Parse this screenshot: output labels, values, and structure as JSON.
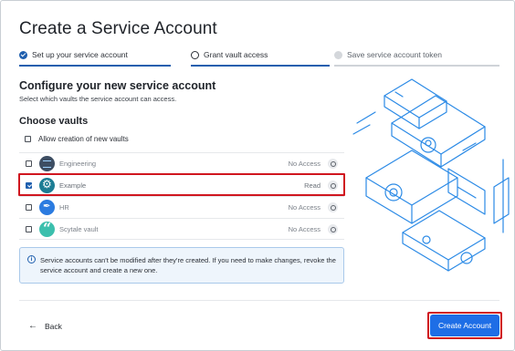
{
  "title": "Create a Service Account",
  "steps": [
    {
      "label": "Set up your service account",
      "state": "done"
    },
    {
      "label": "Grant vault access",
      "state": "current"
    },
    {
      "label": "Save service account token",
      "state": "pending"
    }
  ],
  "section": {
    "heading": "Configure your new service account",
    "subtext": "Select which vaults the service account can access."
  },
  "vaults_section": {
    "heading": "Choose vaults",
    "allow_new_label": "Allow creation of new vaults",
    "allow_new_checked": false,
    "items": [
      {
        "name": "Engineering",
        "access": "No Access",
        "checked": false,
        "icon": "engineering-vault-icon"
      },
      {
        "name": "Example",
        "access": "Read",
        "checked": true,
        "icon": "gear-vault-icon"
      },
      {
        "name": "HR",
        "access": "No Access",
        "checked": false,
        "icon": "pen-vault-icon"
      },
      {
        "name": "Scytale vault",
        "access": "No Access",
        "checked": false,
        "icon": "quote-vault-icon"
      }
    ]
  },
  "notice": {
    "icon": "info-icon",
    "text": "Service accounts can't be modified after they're created. If you need to make changes, revoke the service account and create a new one."
  },
  "footer": {
    "back_label": "Back",
    "create_label": "Create Account"
  },
  "colors": {
    "accent": "#1e6ee6",
    "step_active": "#1f5fae",
    "highlight": "#d0161f",
    "notice_bg": "#eef5fc"
  }
}
